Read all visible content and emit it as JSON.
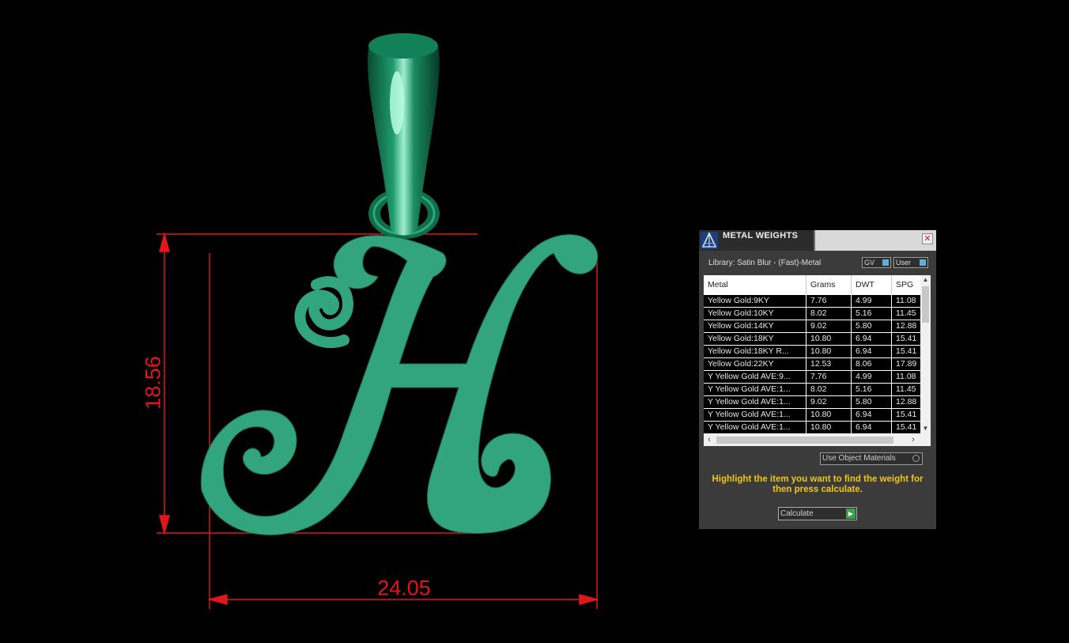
{
  "viewport": {
    "dimension_height": "18.56",
    "dimension_width": "24.05",
    "colors": {
      "background": "#000000",
      "pendant": "#33a57e",
      "dimension_lines": "#e0161b"
    }
  },
  "panel": {
    "title": "METAL WEIGHTS",
    "close_symbol": "✕",
    "library_label": "Library: Satin Blur - (Fast)-Metal",
    "toggle_gv": "GV",
    "toggle_user": "User",
    "table": {
      "headers": [
        "Metal",
        "Grams",
        "DWT",
        "SPG"
      ],
      "rows": [
        [
          "Yellow Gold:9KY",
          "7.76",
          "4.99",
          "11.08"
        ],
        [
          "Yellow Gold:10KY",
          "8.02",
          "5.16",
          "11.45"
        ],
        [
          "Yellow Gold:14KY",
          "9.02",
          "5.80",
          "12.88"
        ],
        [
          "Yellow Gold:18KY",
          "10.80",
          "6.94",
          "15.41"
        ],
        [
          "Yellow Gold:18KY R...",
          "10.80",
          "6.94",
          "15.41"
        ],
        [
          "Yellow Gold:22KY",
          "12.53",
          "8.06",
          "17.89"
        ],
        [
          "Y Yellow Gold AVE:9...",
          "7.76",
          "4.99",
          "11.08"
        ],
        [
          "Y Yellow Gold AVE:1...",
          "8.02",
          "5.16",
          "11.45"
        ],
        [
          "Y Yellow Gold AVE:1...",
          "9.02",
          "5.80",
          "12.88"
        ],
        [
          "Y Yellow Gold AVE:1...",
          "10.80",
          "6.94",
          "15.41"
        ],
        [
          "Y Yellow Gold AVE:1...",
          "10.80",
          "6.94",
          "15.41"
        ]
      ]
    },
    "use_object_materials": "Use Object Materials",
    "instructions": "Highlight the item you want to find the weight for then press calculate.",
    "calculate_label": "Calculate",
    "colors": {
      "panel_bg": "#3b3b3b",
      "instruction_text": "#f0c419",
      "go_button": "#3aa34a"
    }
  }
}
